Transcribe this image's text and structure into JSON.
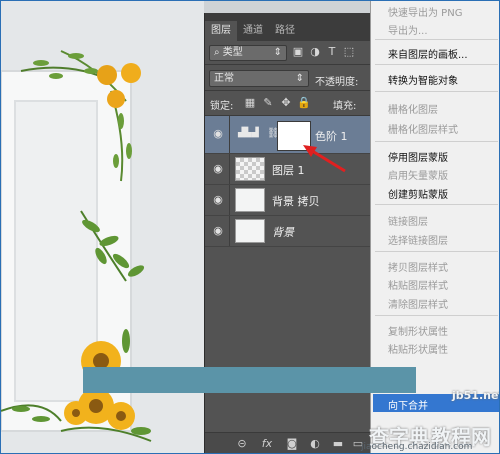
{
  "panel": {
    "tabs": [
      {
        "label": "图层",
        "active": true
      },
      {
        "label": "通道",
        "active": false
      },
      {
        "label": "路径",
        "active": false
      }
    ],
    "filter": {
      "value": "类型"
    },
    "blend_mode": "正常",
    "opacity_label": "不透明度:",
    "lock_label": "锁定:",
    "fill_label": "填充:",
    "layers": [
      {
        "name": "色阶 1",
        "type": "adjustment",
        "selected": true
      },
      {
        "name": "图层 1",
        "type": "pixel",
        "selected": false
      },
      {
        "name": "背景 拷贝",
        "type": "pixel",
        "selected": false
      },
      {
        "name": "背景",
        "type": "background",
        "selected": false
      }
    ],
    "bottom_icons": [
      "link-icon",
      "fx-icon",
      "mask-icon",
      "adjustment-icon",
      "folder-icon",
      "new-layer-icon",
      "trash-icon"
    ],
    "colors": {
      "panel_bg": "#535353",
      "selected_layer": "#6b7d95",
      "arrow": "#e02020"
    }
  },
  "context_menu": {
    "items": [
      {
        "label": "快速导出为 PNG",
        "enabled": false
      },
      {
        "label": "导出为...",
        "enabled": false
      },
      {
        "label": "来自图层的画板...",
        "enabled": true
      },
      {
        "label": "转换为智能对象",
        "enabled": true
      },
      {
        "label": "栅格化图层",
        "enabled": false
      },
      {
        "label": "栅格化图层样式",
        "enabled": false
      },
      {
        "label": "停用图层蒙版",
        "enabled": true
      },
      {
        "label": "启用矢量蒙版",
        "enabled": false
      },
      {
        "label": "创建剪贴蒙版",
        "enabled": true
      },
      {
        "label": "链接图层",
        "enabled": false
      },
      {
        "label": "选择链接图层",
        "enabled": false
      },
      {
        "label": "拷贝图层样式",
        "enabled": false
      },
      {
        "label": "粘贴图层样式",
        "enabled": false
      },
      {
        "label": "清除图层样式",
        "enabled": false
      },
      {
        "label": "复制形状属性",
        "enabled": false
      },
      {
        "label": "粘贴形状属性",
        "enabled": false
      },
      {
        "label": "向下合并",
        "enabled": true,
        "highlighted": true
      }
    ],
    "highlight_color": "#3477d0"
  },
  "watermark": {
    "site": "jb51.net",
    "pinyin": "jiaocheng.chazidian.com",
    "line1": "查字典",
    "line2": "教程网"
  }
}
